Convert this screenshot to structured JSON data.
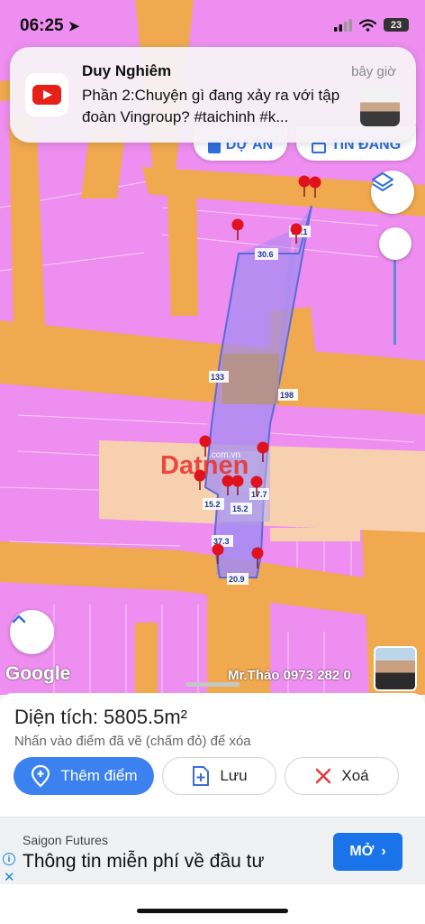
{
  "status": {
    "time": "06:25",
    "battery": "23"
  },
  "notification": {
    "app": "youtube-icon",
    "title": "Duy Nghiêm",
    "time": "bây giờ",
    "body": "Phần 2:Chuyện gì đang xảy ra với tập đoàn Vingroup? #taichinh #k..."
  },
  "top_buttons": {
    "left": "DỰ ÁN",
    "right": "TIN ĐĂNG"
  },
  "map": {
    "logo": "Google",
    "contact": "Mr.Thảo 0973 282 0",
    "watermark": "Datnen",
    "watermark_sub": ".com.vn",
    "labels": [
      "26.1",
      "30.6",
      "133",
      "198",
      "17.7",
      "15.2",
      "15.2",
      "37.3",
      "20.9"
    ]
  },
  "sheet": {
    "area_label": "Diện tích: 5805.5m²",
    "hint": "Nhấn vào điểm đã vẽ (chấm đỏ) để xóa",
    "add_button": "Thêm điểm",
    "save_button": "Lưu",
    "delete_button": "Xoá"
  },
  "ad": {
    "brand": "Saigon Futures",
    "text": "Thông tin miễn phí về đầu tư",
    "cta": "MỞ"
  },
  "colors": {
    "accent": "#3b82f0",
    "land": "#ee8ef0",
    "road": "#f0a94e",
    "parcel": "#9b84f0",
    "pin": "#e0121e"
  }
}
